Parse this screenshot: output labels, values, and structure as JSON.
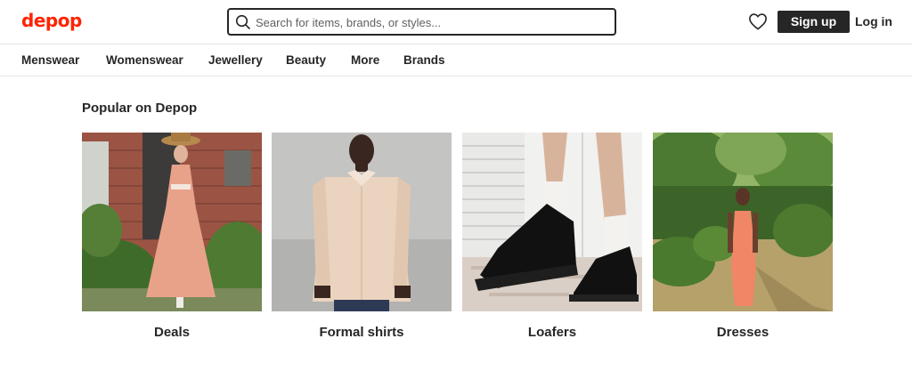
{
  "header": {
    "logo": "depop",
    "search_placeholder": "Search for items, brands, or styles...",
    "signup_label": "Sign up",
    "login_label": "Log in"
  },
  "nav": {
    "items": [
      "Menswear",
      "Womenswear",
      "Jewellery",
      "Beauty",
      "More",
      "Brands"
    ]
  },
  "popular": {
    "title": "Popular on Depop",
    "cards": [
      {
        "label": "Deals"
      },
      {
        "label": "Formal shirts"
      },
      {
        "label": "Loafers"
      },
      {
        "label": "Dresses"
      }
    ]
  },
  "colors": {
    "brand": "#ff2300",
    "text": "#262626"
  }
}
